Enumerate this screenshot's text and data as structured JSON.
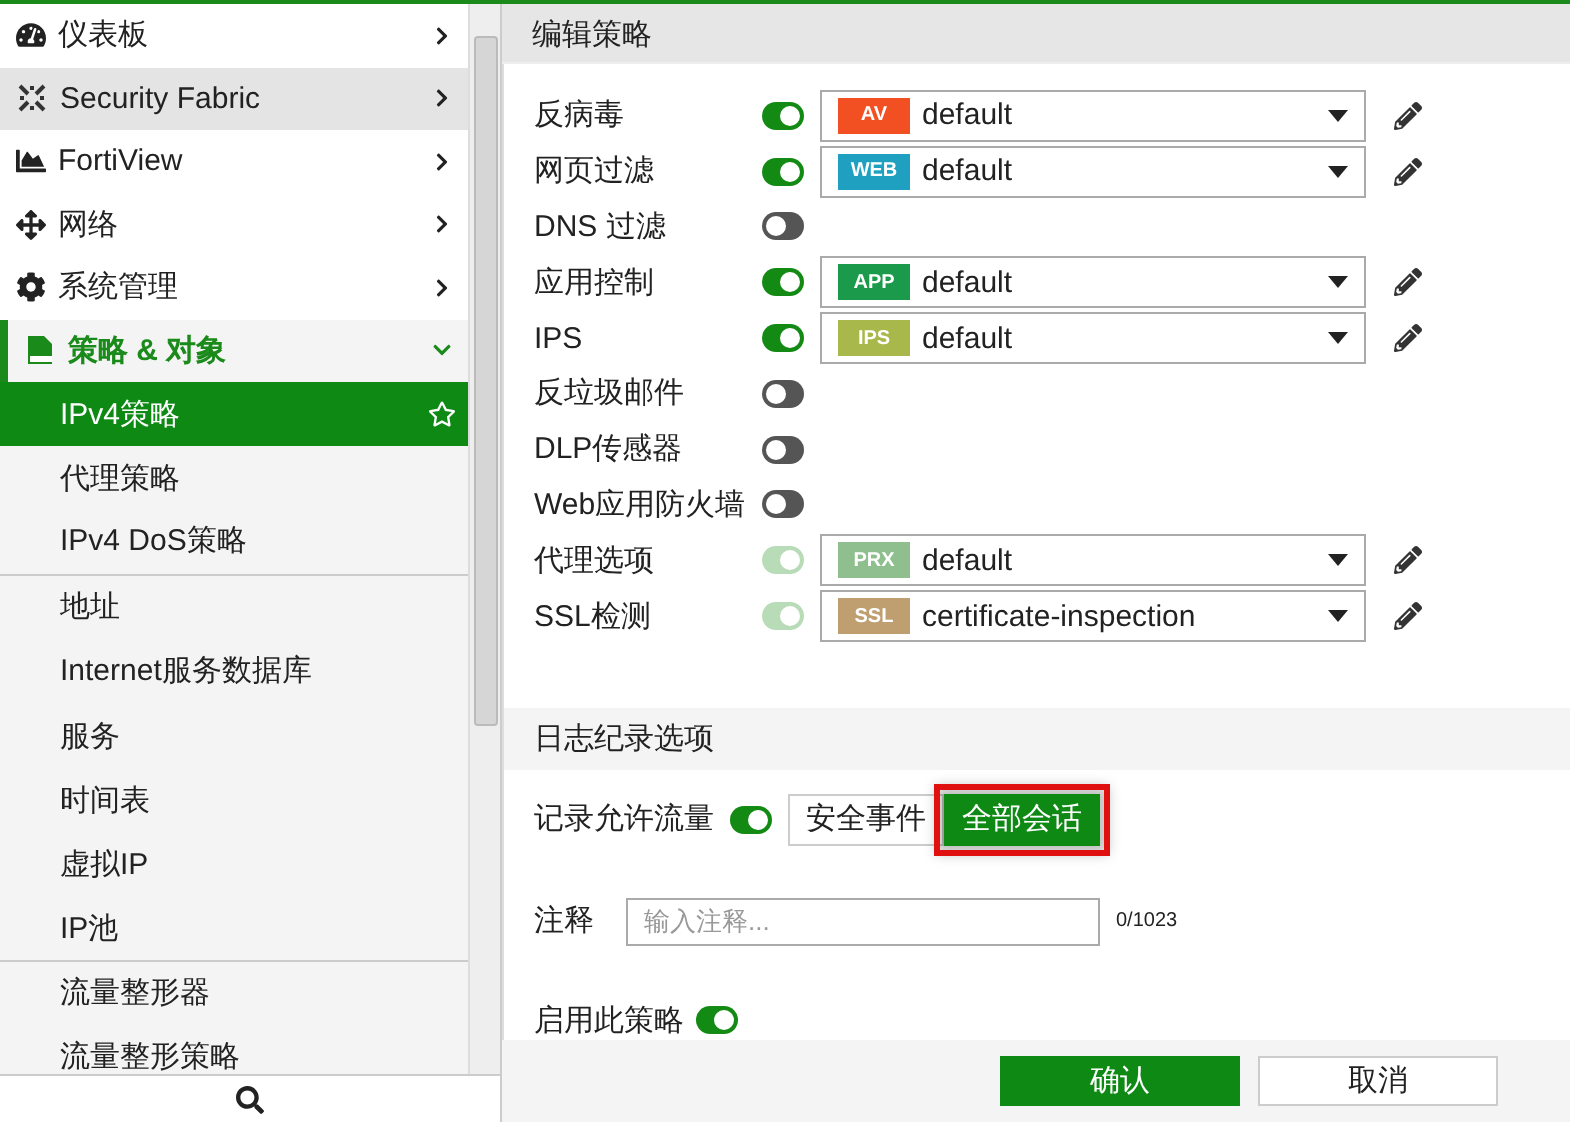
{
  "sidebar": {
    "items": [
      {
        "label": "仪表板",
        "highlighted": false
      },
      {
        "label": "Security Fabric",
        "highlighted": true
      },
      {
        "label": "FortiView",
        "highlighted": false
      },
      {
        "label": "网络",
        "highlighted": false
      },
      {
        "label": "系统管理",
        "highlighted": false
      },
      {
        "label": "策略 & 对象",
        "highlighted": false,
        "expanded": true,
        "children": [
          {
            "label": "IPv4策略",
            "selected": true,
            "divider_after": false
          },
          {
            "label": "代理策略",
            "selected": false,
            "divider_after": false
          },
          {
            "label": "IPv4 DoS策略",
            "selected": false,
            "divider_after": true
          },
          {
            "label": "地址",
            "selected": false,
            "divider_after": false
          },
          {
            "label": "Internet服务数据库",
            "selected": false,
            "divider_after": false
          },
          {
            "label": "服务",
            "selected": false,
            "divider_after": false
          },
          {
            "label": "时间表",
            "selected": false,
            "divider_after": false
          },
          {
            "label": "虚拟IP",
            "selected": false,
            "divider_after": false
          },
          {
            "label": "IP池",
            "selected": false,
            "divider_after": true
          },
          {
            "label": "流量整形器",
            "selected": false,
            "divider_after": false
          },
          {
            "label": "流量整形策略",
            "selected": false,
            "divider_after": false
          }
        ]
      }
    ]
  },
  "panel": {
    "title": "编辑策略",
    "profiles": [
      {
        "label": "反病毒",
        "on": true,
        "disabled": false,
        "profile": {
          "tag": "AV",
          "color": "#f25022",
          "value": "default"
        }
      },
      {
        "label": "网页过滤",
        "on": true,
        "disabled": false,
        "profile": {
          "tag": "WEB",
          "color": "#1fa0c0",
          "value": "default"
        }
      },
      {
        "label": "DNS 过滤",
        "on": false
      },
      {
        "label": "应用控制",
        "on": true,
        "disabled": false,
        "profile": {
          "tag": "APP",
          "color": "#1a9a4a",
          "value": "default"
        }
      },
      {
        "label": "IPS",
        "on": true,
        "disabled": false,
        "profile": {
          "tag": "IPS",
          "color": "#a9b84a",
          "value": "default"
        }
      },
      {
        "label": "反垃圾邮件",
        "on": false
      },
      {
        "label": "DLP传感器",
        "on": false
      },
      {
        "label": "Web应用防火墙",
        "on": false
      },
      {
        "label": "代理选项",
        "on": true,
        "disabled": true,
        "profile": {
          "tag": "PRX",
          "color": "#8fbf8f",
          "value": "default"
        }
      },
      {
        "label": "SSL检测",
        "on": true,
        "disabled": true,
        "profile": {
          "tag": "SSL",
          "color": "#bf9f70",
          "value": "certificate-inspection"
        }
      }
    ],
    "logging": {
      "title": "日志纪录选项",
      "label": "记录允许流量",
      "on": true,
      "options": [
        {
          "label": "安全事件",
          "selected": false,
          "outlined": false
        },
        {
          "label": "全部会话",
          "selected": true,
          "outlined": true
        }
      ]
    },
    "comment": {
      "label": "注释",
      "placeholder": "输入注释...",
      "counter": "0/1023"
    },
    "enable": {
      "label": "启用此策略",
      "on": true
    },
    "buttons": [
      {
        "label": "确认",
        "kind": "primary"
      },
      {
        "label": "取消",
        "kind": "secondary"
      }
    ]
  }
}
